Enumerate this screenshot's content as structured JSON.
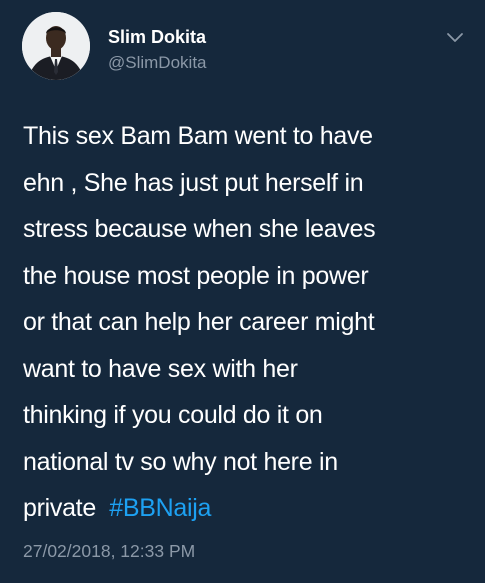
{
  "author": {
    "display_name": "Slim Dokita",
    "handle": "@SlimDokita",
    "avatar_icon": "profile-photo"
  },
  "menu_icon": "chevron-down-icon",
  "tweet": {
    "lines": [
      "This sex Bam Bam went to have",
      "ehn , She has just put herself in",
      "stress because when she leaves",
      "the house most people in power",
      "or that can help her career might",
      "want to have sex with her",
      "thinking if you could do it on",
      "national tv so why not here in"
    ],
    "last_line_prefix": "private",
    "hashtag": "#BBNaija"
  },
  "timestamp": "27/02/2018, 12:33 PM",
  "colors": {
    "background": "#15283c",
    "text": "#ffffff",
    "secondary": "#8b98a7",
    "link": "#1da1f2"
  }
}
